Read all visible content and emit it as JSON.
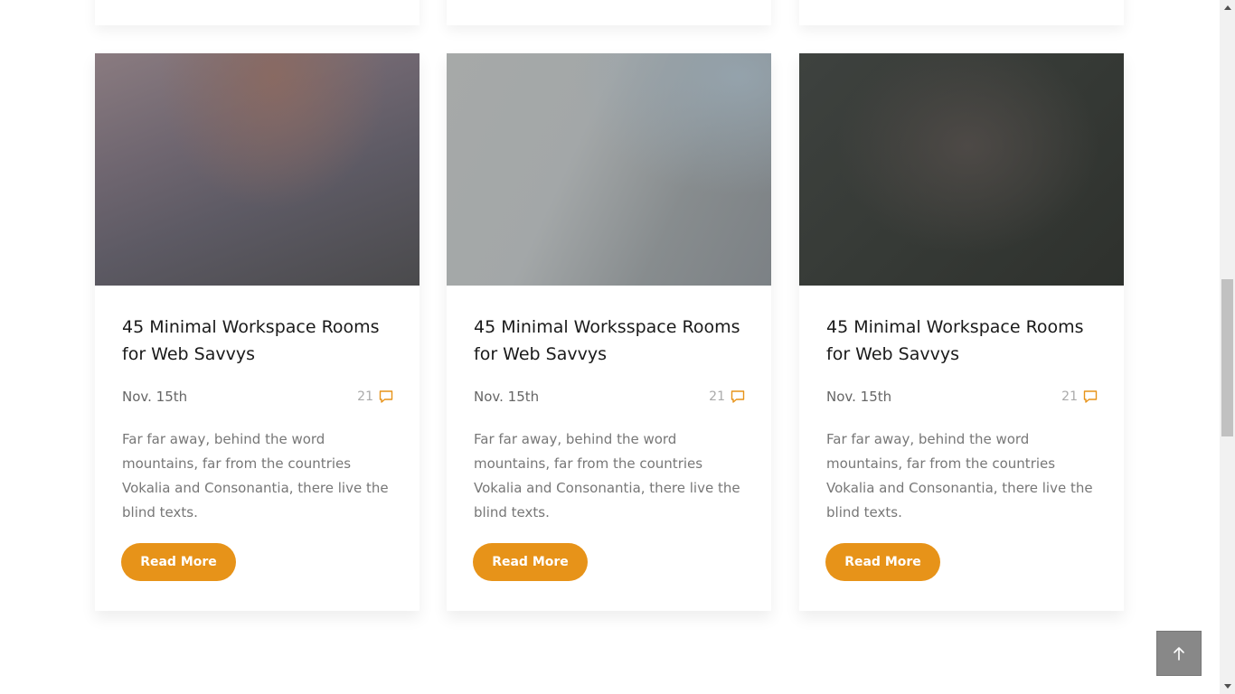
{
  "blog_posts": [
    {
      "title": "45 Minimal Workspace Rooms for Web Savvys",
      "date": "Nov. 15th",
      "comment_count": "21",
      "excerpt": "Far far away, behind the word mountains, far from the countries Vokalia and Consonantia, there live the blind texts.",
      "button_label": "Read More"
    },
    {
      "title": "45 Minimal Worksspace Rooms for Web Savvys",
      "date": "Nov. 15th",
      "comment_count": "21",
      "excerpt": "Far far away, behind the word mountains, far from the countries Vokalia and Consonantia, there live the blind texts.",
      "button_label": "Read More"
    },
    {
      "title": "45 Minimal Workspace Rooms for Web Savvys",
      "date": "Nov. 15th",
      "comment_count": "21",
      "excerpt": "Far far away, behind the word mountains, far from the countries Vokalia and Consonantia, there live the blind texts.",
      "button_label": "Read More"
    }
  ],
  "icons": {
    "comment": "comment-icon",
    "back_to_top": "arrow-up-icon"
  },
  "colors": {
    "accent": "#e79319",
    "back_to_top_bg": "#888888"
  }
}
